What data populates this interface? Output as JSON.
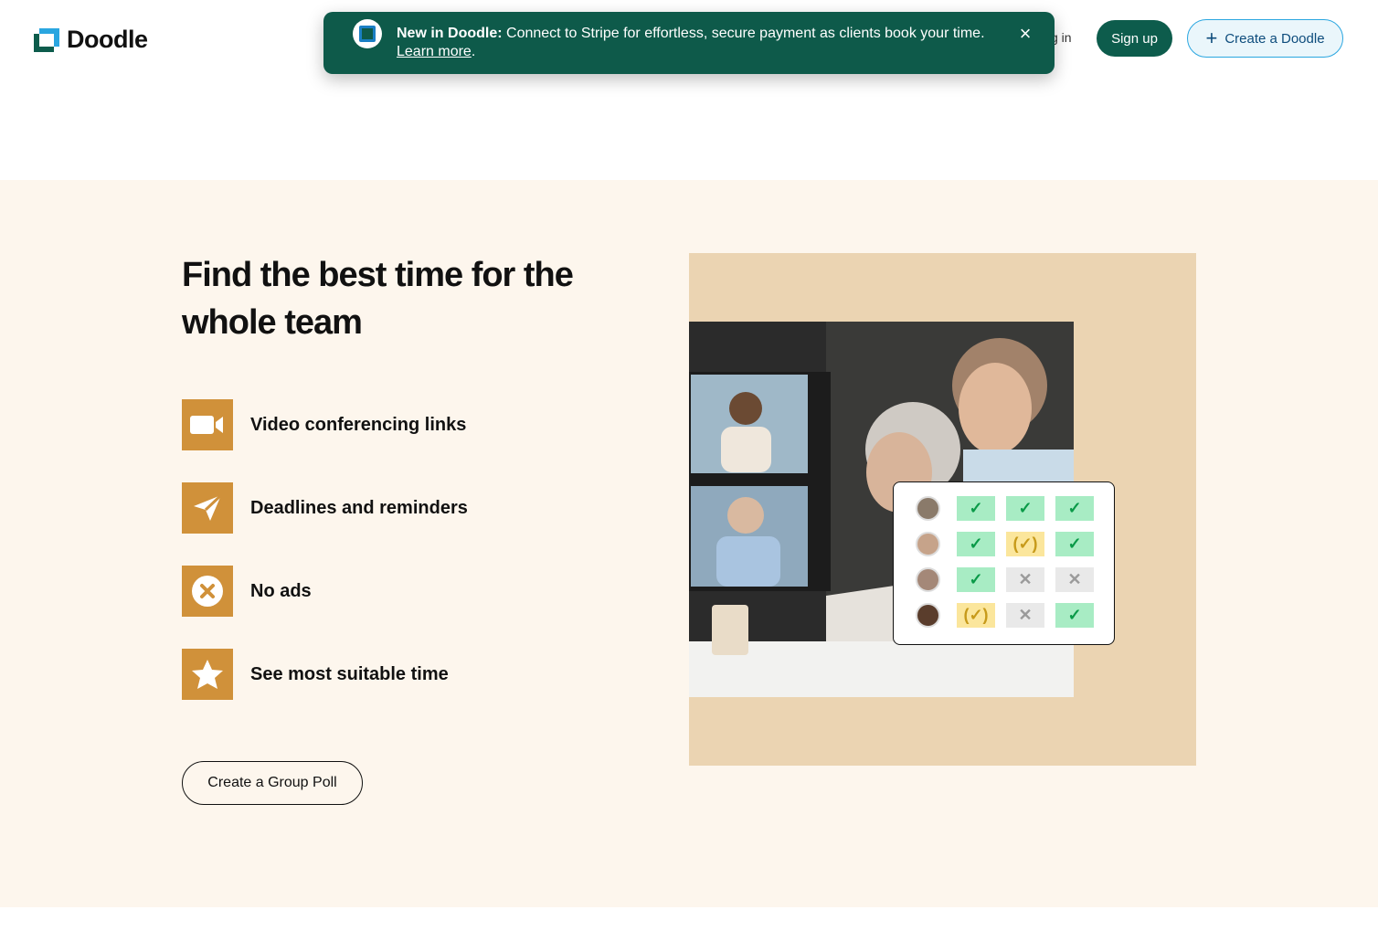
{
  "header": {
    "logo_text": "Doodle",
    "login_label": "g in",
    "signup_label": "Sign up",
    "create_label": "Create a Doodle"
  },
  "banner": {
    "bold": "New in Doodle:",
    "text": " Connect to Stripe for effortless, secure payment as clients book your time. ",
    "link": "Learn more",
    "suffix": ".",
    "close": "×"
  },
  "hero": {
    "title": "Find the best time for the whole team",
    "features": [
      {
        "label": "Video conferencing links",
        "icon": "video-camera-icon"
      },
      {
        "label": "Deadlines and reminders",
        "icon": "paper-plane-icon"
      },
      {
        "label": "No ads",
        "icon": "x-circle-icon"
      },
      {
        "label": "See most suitable time",
        "icon": "star-icon"
      }
    ],
    "cta_label": "Create a Group Poll"
  },
  "poll_grid": {
    "rows": [
      [
        "yes",
        "yes",
        "yes"
      ],
      [
        "yes",
        "maybe",
        "yes"
      ],
      [
        "yes",
        "no",
        "no"
      ],
      [
        "maybe",
        "no",
        "yes"
      ]
    ],
    "symbols": {
      "yes": "✓",
      "maybe": "(✓)",
      "no": "✕"
    }
  },
  "colors": {
    "brand_green": "#0d5c4c",
    "accent_blue": "#2aa6e0",
    "feature_gold": "#d0913a",
    "section_bg": "#fdf6ed",
    "illus_bg": "#ebd4b2"
  }
}
